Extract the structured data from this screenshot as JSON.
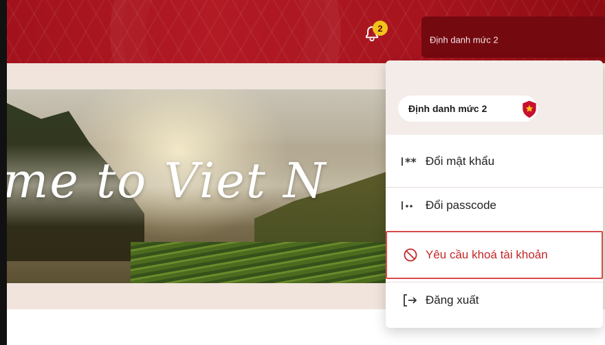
{
  "header": {
    "notification_count": "2",
    "user_identity_level": "Định danh mức 2"
  },
  "banner": {
    "text": "me to Viet N"
  },
  "dropdown": {
    "identity_level_label": "Định danh mức 2",
    "items": [
      {
        "label": "Đổi mật khẩu",
        "icon": "password-icon"
      },
      {
        "label": "Đổi passcode",
        "icon": "passcode-icon"
      },
      {
        "label": "Yêu cầu khoá tài khoản",
        "icon": "block-icon"
      },
      {
        "label": "Đăng xuất",
        "icon": "logout-icon"
      }
    ]
  },
  "colors": {
    "header_red": "#a2121c",
    "danger_red": "#c22626",
    "badge_yellow": "#f3c21b"
  }
}
